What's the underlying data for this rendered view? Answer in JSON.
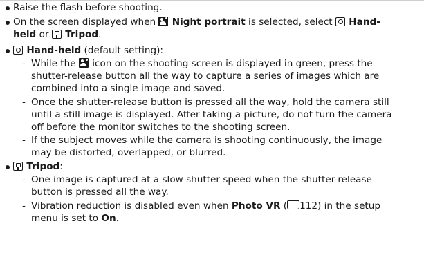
{
  "icons": [
    "night-portrait-icon",
    "hand-held-icon",
    "tripod-icon",
    "manual-reference-icon"
  ],
  "bullet1": "Raise the flash before shooting.",
  "bullet2": {
    "pre": "On the screen displayed when",
    "night_portrait": "Night portrait",
    "mid": "is selected, select",
    "handheld_a": "Hand-",
    "handheld_b": "held",
    "or": "or",
    "tripod": "Tripod",
    "end": "."
  },
  "bullet3": {
    "label": "Hand-held",
    "suffix": "(default setting):",
    "sub1": {
      "line1_pre": "While the",
      "line1_post": "icon on the shooting screen is displayed in green, press the",
      "line2": "shutter-release button all the way to capture a series of images which are",
      "line3": "combined into a single image and saved."
    },
    "sub2": {
      "line1": "Once the shutter-release button is pressed all the way, hold the camera still",
      "line2": "until a still image is displayed. After taking a picture, do not turn the camera",
      "line3": "off before the monitor switches to the shooting screen."
    },
    "sub3": {
      "line1": "If the subject moves while the camera is shooting continuously, the image",
      "line2": "may be distorted, overlapped, or blurred."
    }
  },
  "bullet4": {
    "label": "Tripod",
    "suffix": ":",
    "sub1": {
      "line1": "One image is captured at a slow shutter speed when the shutter-release",
      "line2": "button is pressed all the way."
    },
    "sub2": {
      "line1_pre": "Vibration reduction is disabled even when",
      "photo_vr": "Photo VR",
      "page_ref": "112)",
      "line1_post": "in the setup",
      "line2_pre": "menu is set to",
      "on": "On",
      "line2_end": "."
    }
  },
  "dash": "-"
}
